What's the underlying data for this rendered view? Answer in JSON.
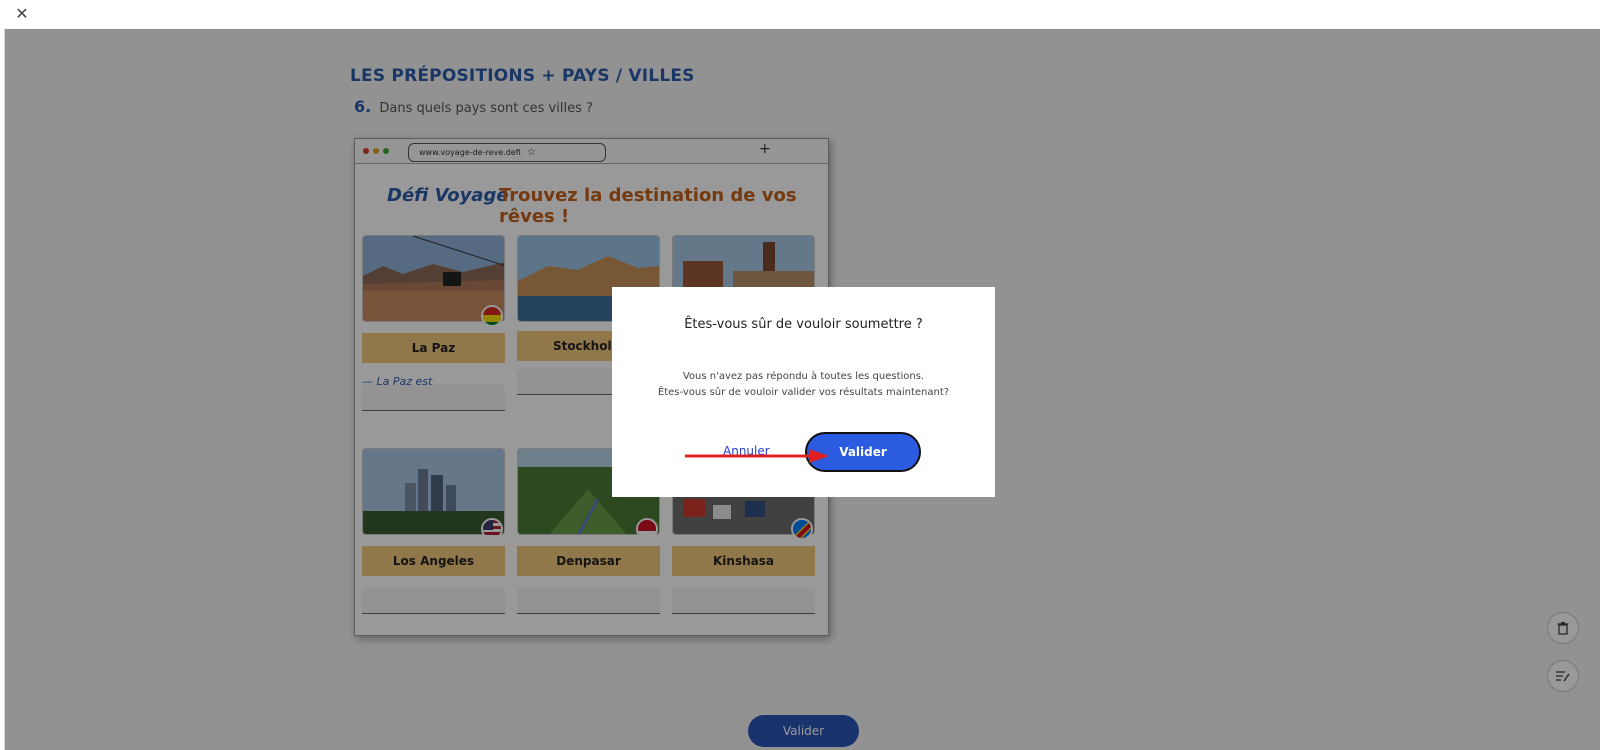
{
  "topbar": {
    "close_icon": "close-icon"
  },
  "exercise": {
    "title": "LES PRÉPOSITIONS + PAYS / VILLES",
    "number": "6.",
    "question": "Dans quels pays sont ces villes ?"
  },
  "mockup": {
    "url": "www.voyage-de-reve.defi",
    "plus": "+",
    "brand": "Défi Voyage",
    "tagline": "Trouvez la destination de vos rêves !",
    "cards": [
      {
        "city": "La Paz",
        "hint": "— La Paz est"
      },
      {
        "city": "Stockholm",
        "hint": ""
      },
      {
        "city": "",
        "hint": ""
      },
      {
        "city": "Los Angeles",
        "hint": ""
      },
      {
        "city": "Denpasar",
        "hint": ""
      },
      {
        "city": "Kinshasa",
        "hint": ""
      }
    ]
  },
  "bottom": {
    "validate_label": "Valider"
  },
  "modal": {
    "title": "Êtes-vous sûr de vouloir soumettre ?",
    "line1": "Vous n'avez pas répondu à toutes les questions.",
    "line2": "Êtes-vous sûr de vouloir valider vos résultats maintenant?",
    "cancel_label": "Annuler",
    "confirm_label": "Valider"
  },
  "colors": {
    "accent": "#2b55b8",
    "title": "#2c5aa8",
    "tagline": "#c2601a",
    "card_label": "#f2c87e",
    "arrow": "#e02020"
  }
}
